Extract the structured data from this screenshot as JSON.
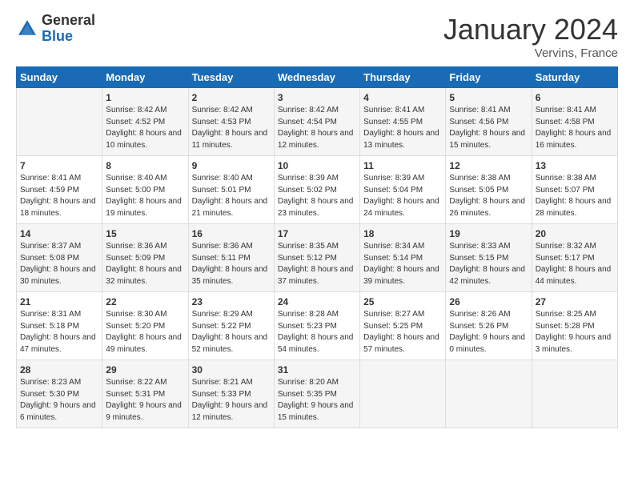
{
  "header": {
    "logo_general": "General",
    "logo_blue": "Blue",
    "month_title": "January 2024",
    "location": "Vervins, France"
  },
  "days_of_week": [
    "Sunday",
    "Monday",
    "Tuesday",
    "Wednesday",
    "Thursday",
    "Friday",
    "Saturday"
  ],
  "weeks": [
    [
      {
        "day": "",
        "sunrise": "",
        "sunset": "",
        "daylight": ""
      },
      {
        "day": "1",
        "sunrise": "8:42 AM",
        "sunset": "4:52 PM",
        "daylight": "8 hours and 10 minutes."
      },
      {
        "day": "2",
        "sunrise": "8:42 AM",
        "sunset": "4:53 PM",
        "daylight": "8 hours and 11 minutes."
      },
      {
        "day": "3",
        "sunrise": "8:42 AM",
        "sunset": "4:54 PM",
        "daylight": "8 hours and 12 minutes."
      },
      {
        "day": "4",
        "sunrise": "8:41 AM",
        "sunset": "4:55 PM",
        "daylight": "8 hours and 13 minutes."
      },
      {
        "day": "5",
        "sunrise": "8:41 AM",
        "sunset": "4:56 PM",
        "daylight": "8 hours and 15 minutes."
      },
      {
        "day": "6",
        "sunrise": "8:41 AM",
        "sunset": "4:58 PM",
        "daylight": "8 hours and 16 minutes."
      }
    ],
    [
      {
        "day": "7",
        "sunrise": "8:41 AM",
        "sunset": "4:59 PM",
        "daylight": "8 hours and 18 minutes."
      },
      {
        "day": "8",
        "sunrise": "8:40 AM",
        "sunset": "5:00 PM",
        "daylight": "8 hours and 19 minutes."
      },
      {
        "day": "9",
        "sunrise": "8:40 AM",
        "sunset": "5:01 PM",
        "daylight": "8 hours and 21 minutes."
      },
      {
        "day": "10",
        "sunrise": "8:39 AM",
        "sunset": "5:02 PM",
        "daylight": "8 hours and 23 minutes."
      },
      {
        "day": "11",
        "sunrise": "8:39 AM",
        "sunset": "5:04 PM",
        "daylight": "8 hours and 24 minutes."
      },
      {
        "day": "12",
        "sunrise": "8:38 AM",
        "sunset": "5:05 PM",
        "daylight": "8 hours and 26 minutes."
      },
      {
        "day": "13",
        "sunrise": "8:38 AM",
        "sunset": "5:07 PM",
        "daylight": "8 hours and 28 minutes."
      }
    ],
    [
      {
        "day": "14",
        "sunrise": "8:37 AM",
        "sunset": "5:08 PM",
        "daylight": "8 hours and 30 minutes."
      },
      {
        "day": "15",
        "sunrise": "8:36 AM",
        "sunset": "5:09 PM",
        "daylight": "8 hours and 32 minutes."
      },
      {
        "day": "16",
        "sunrise": "8:36 AM",
        "sunset": "5:11 PM",
        "daylight": "8 hours and 35 minutes."
      },
      {
        "day": "17",
        "sunrise": "8:35 AM",
        "sunset": "5:12 PM",
        "daylight": "8 hours and 37 minutes."
      },
      {
        "day": "18",
        "sunrise": "8:34 AM",
        "sunset": "5:14 PM",
        "daylight": "8 hours and 39 minutes."
      },
      {
        "day": "19",
        "sunrise": "8:33 AM",
        "sunset": "5:15 PM",
        "daylight": "8 hours and 42 minutes."
      },
      {
        "day": "20",
        "sunrise": "8:32 AM",
        "sunset": "5:17 PM",
        "daylight": "8 hours and 44 minutes."
      }
    ],
    [
      {
        "day": "21",
        "sunrise": "8:31 AM",
        "sunset": "5:18 PM",
        "daylight": "8 hours and 47 minutes."
      },
      {
        "day": "22",
        "sunrise": "8:30 AM",
        "sunset": "5:20 PM",
        "daylight": "8 hours and 49 minutes."
      },
      {
        "day": "23",
        "sunrise": "8:29 AM",
        "sunset": "5:22 PM",
        "daylight": "8 hours and 52 minutes."
      },
      {
        "day": "24",
        "sunrise": "8:28 AM",
        "sunset": "5:23 PM",
        "daylight": "8 hours and 54 minutes."
      },
      {
        "day": "25",
        "sunrise": "8:27 AM",
        "sunset": "5:25 PM",
        "daylight": "8 hours and 57 minutes."
      },
      {
        "day": "26",
        "sunrise": "8:26 AM",
        "sunset": "5:26 PM",
        "daylight": "9 hours and 0 minutes."
      },
      {
        "day": "27",
        "sunrise": "8:25 AM",
        "sunset": "5:28 PM",
        "daylight": "9 hours and 3 minutes."
      }
    ],
    [
      {
        "day": "28",
        "sunrise": "8:23 AM",
        "sunset": "5:30 PM",
        "daylight": "9 hours and 6 minutes."
      },
      {
        "day": "29",
        "sunrise": "8:22 AM",
        "sunset": "5:31 PM",
        "daylight": "9 hours and 9 minutes."
      },
      {
        "day": "30",
        "sunrise": "8:21 AM",
        "sunset": "5:33 PM",
        "daylight": "9 hours and 12 minutes."
      },
      {
        "day": "31",
        "sunrise": "8:20 AM",
        "sunset": "5:35 PM",
        "daylight": "9 hours and 15 minutes."
      },
      {
        "day": "",
        "sunrise": "",
        "sunset": "",
        "daylight": ""
      },
      {
        "day": "",
        "sunrise": "",
        "sunset": "",
        "daylight": ""
      },
      {
        "day": "",
        "sunrise": "",
        "sunset": "",
        "daylight": ""
      }
    ]
  ],
  "labels": {
    "sunrise_prefix": "Sunrise: ",
    "sunset_prefix": "Sunset: ",
    "daylight_prefix": "Daylight: "
  }
}
